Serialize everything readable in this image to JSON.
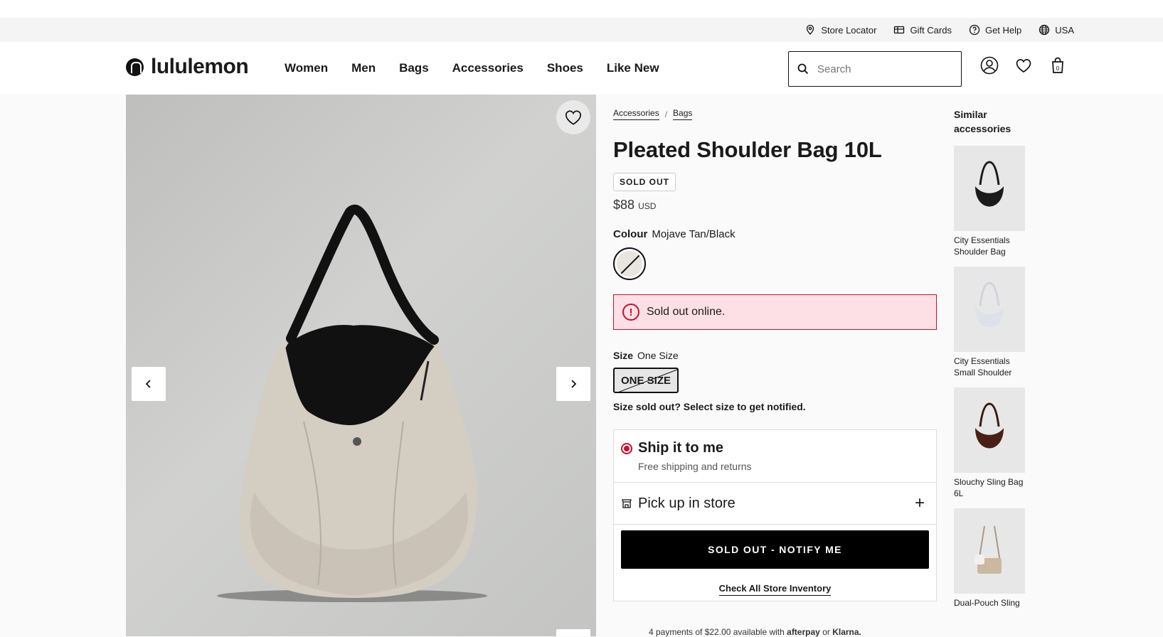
{
  "utility": {
    "store_locator": "Store Locator",
    "gift_cards": "Gift Cards",
    "get_help": "Get Help",
    "region": "USA"
  },
  "header": {
    "logo": "lululemon",
    "nav": [
      "Women",
      "Men",
      "Bags",
      "Accessories",
      "Shoes",
      "Like New"
    ],
    "search_placeholder": "Search",
    "cart_count": "0"
  },
  "breadcrumb": [
    "Accessories",
    "Bags"
  ],
  "product": {
    "title": "Pleated Shoulder Bag 10L",
    "badge": "SOLD OUT",
    "price": "$88",
    "currency": "USD",
    "colour_label": "Colour",
    "colour_value": "Mojave Tan/Black",
    "alert": "Sold out online.",
    "size_label": "Size",
    "size_value": "One Size",
    "size_button": "ONE SIZE",
    "size_notify": "Size sold out? Select size to get notified.",
    "ship_title": "Ship it to me",
    "ship_sub": "Free shipping and returns",
    "pickup_title": "Pick up in store",
    "cta": "SOLD OUT - NOTIFY ME",
    "inventory_link": "Check All Store Inventory",
    "afterpay_text": "4 payments of $22.00 available with",
    "afterpay_brand": "afterpay",
    "or": "or",
    "klarna": "Klarna."
  },
  "similar": {
    "title": "Similar accessories",
    "items": [
      {
        "label": "City Essentials Shoulder Bag",
        "color": "#1b1b1b"
      },
      {
        "label": "City Essentials Small Shoulder",
        "color": "#d9dde6"
      },
      {
        "label": "Slouchy Sling Bag 6L",
        "color": "#4a1f14"
      },
      {
        "label": "Dual-Pouch Sling",
        "color": "#c9b9a0"
      }
    ]
  }
}
